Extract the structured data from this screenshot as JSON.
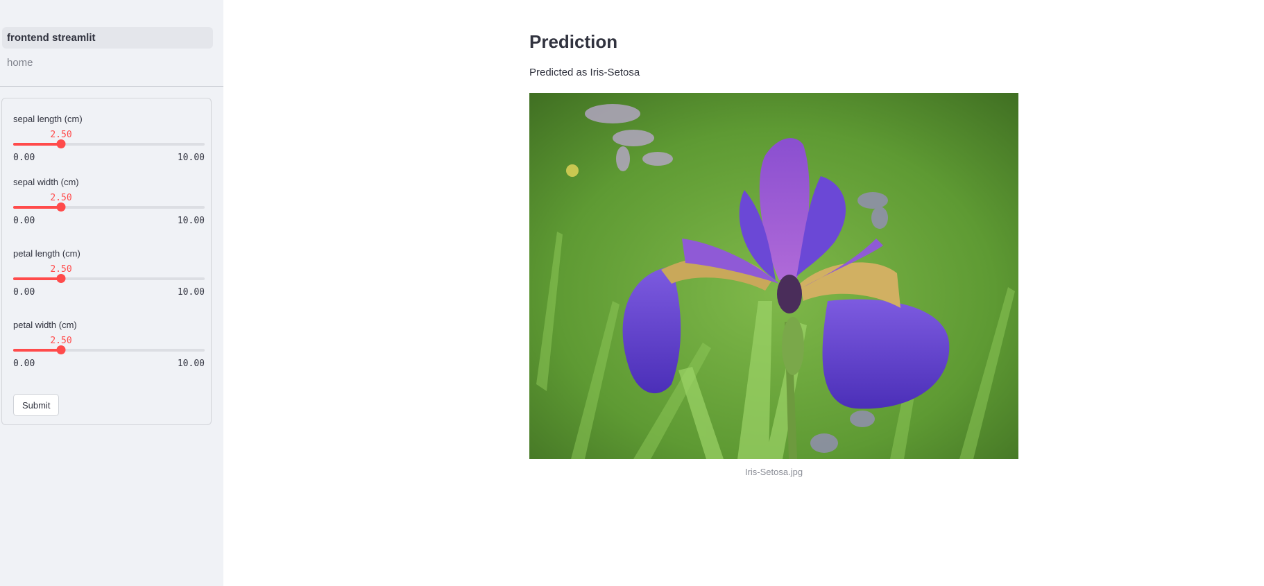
{
  "sidebar": {
    "nav": [
      {
        "label": "frontend streamlit",
        "active": true
      },
      {
        "label": "home",
        "active": false
      }
    ],
    "sliders": [
      {
        "label": "sepal length (cm)",
        "value_text": "2.50",
        "value": 2.5,
        "min": 0,
        "max": 10,
        "min_text": "0.00",
        "max_text": "10.00"
      },
      {
        "label": "sepal width (cm)",
        "value_text": "2.50",
        "value": 2.5,
        "min": 0,
        "max": 10,
        "min_text": "0.00",
        "max_text": "10.00"
      },
      {
        "label": "petal length (cm)",
        "value_text": "2.50",
        "value": 2.5,
        "min": 0,
        "max": 10,
        "min_text": "0.00",
        "max_text": "10.00"
      },
      {
        "label": "petal width (cm)",
        "value_text": "2.50",
        "value": 2.5,
        "min": 0,
        "max": 10,
        "min_text": "0.00",
        "max_text": "10.00"
      }
    ],
    "submit_label": "Submit"
  },
  "main": {
    "title": "Prediction",
    "prediction_text": "Predicted as Iris-Setosa",
    "image_caption": "Iris-Setosa.jpg"
  },
  "colors": {
    "accent": "#ff4b4b",
    "sidebar_bg": "#f0f2f6",
    "text": "#31333f",
    "caption": "#8a8d96"
  }
}
